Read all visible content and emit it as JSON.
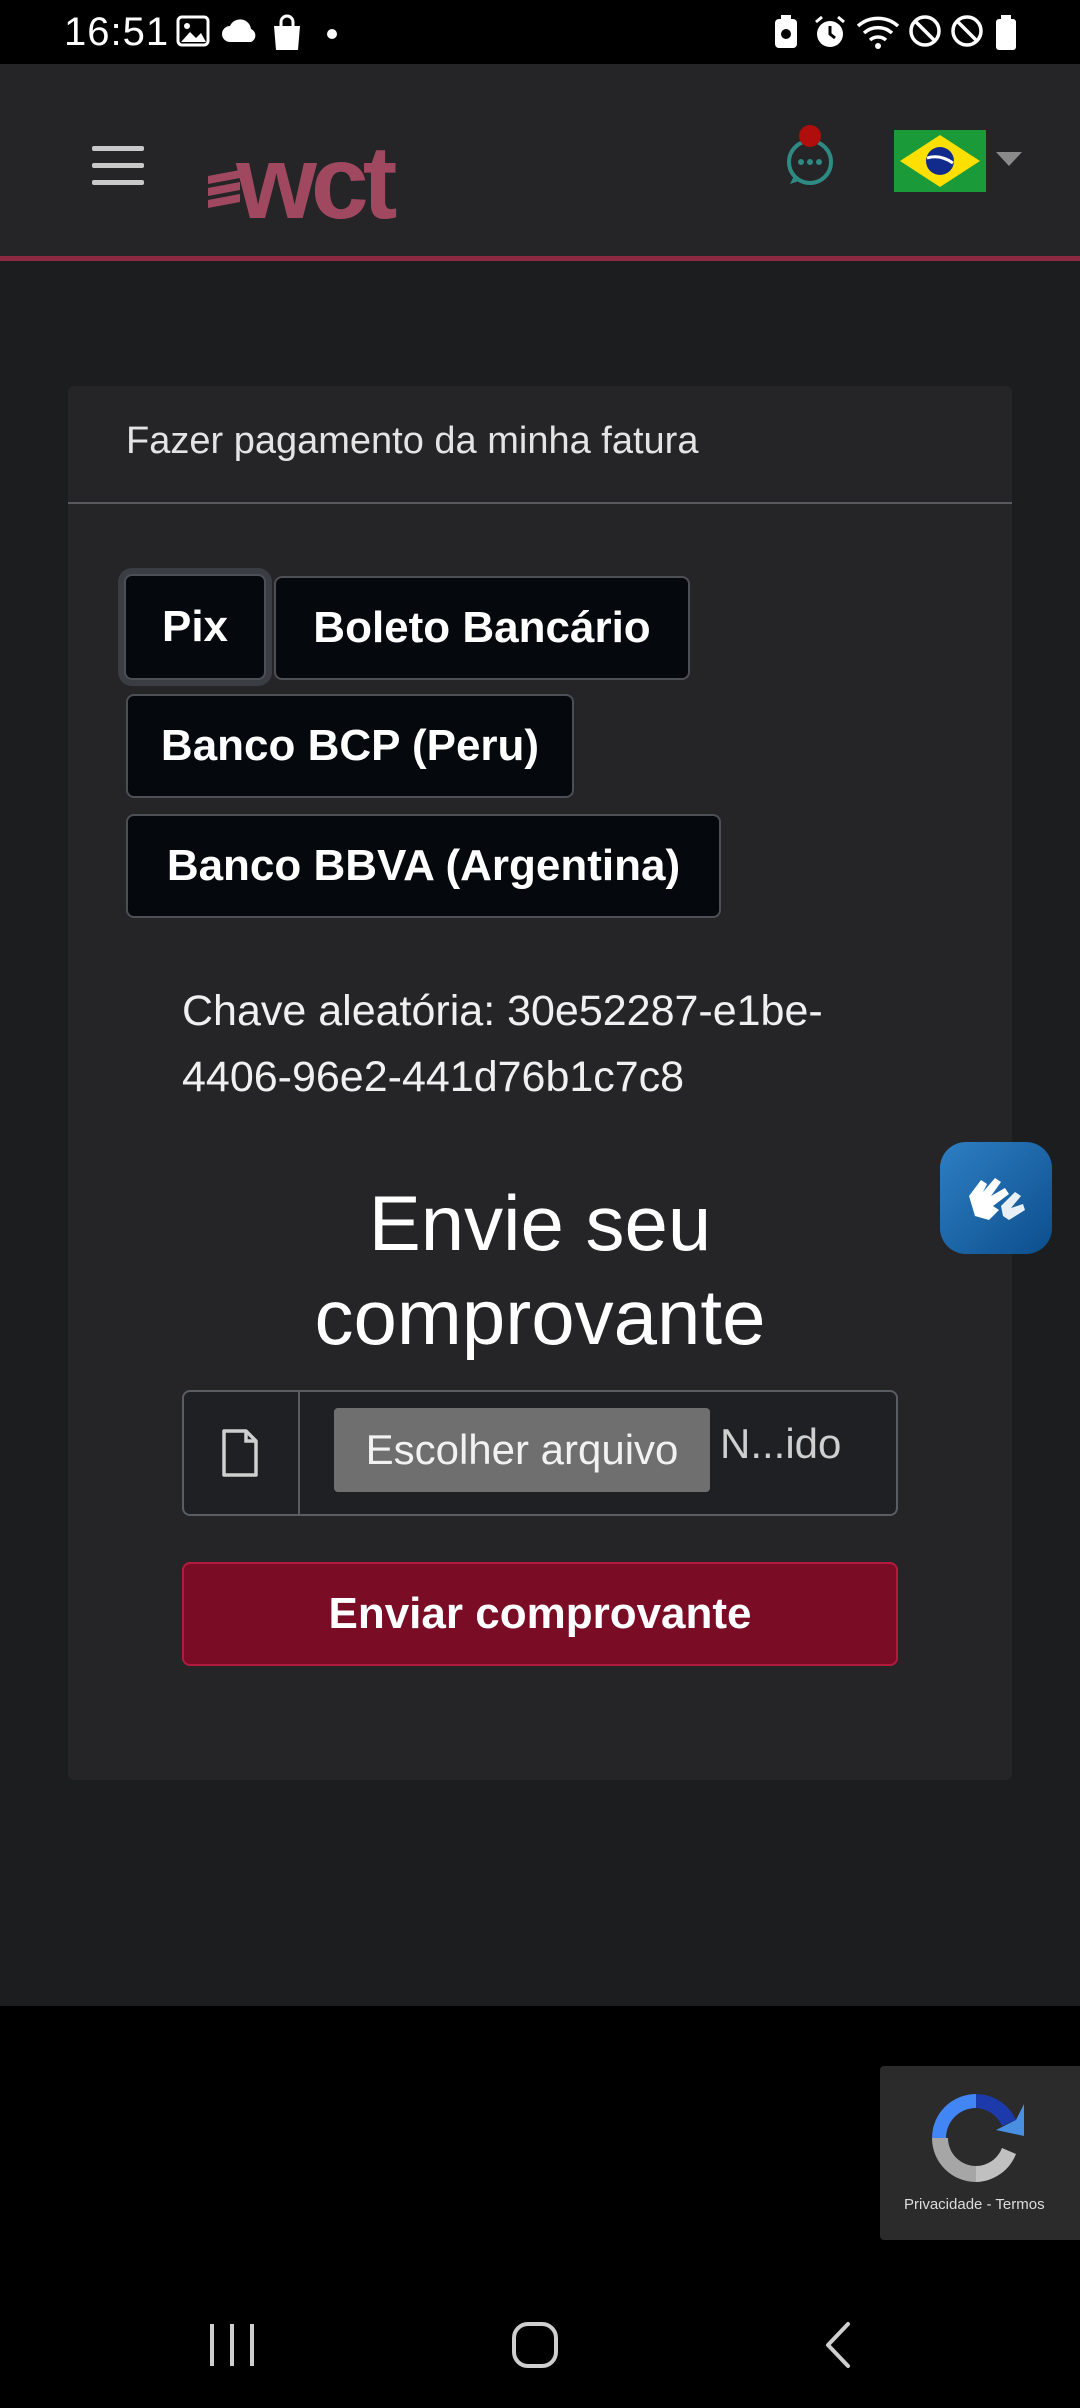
{
  "status_bar": {
    "time": "16:51",
    "left_icons": [
      "image-icon",
      "cloud-icon",
      "shopping-bag-icon",
      "dot-icon"
    ],
    "right_icons": [
      "battery-saver-icon",
      "alarm-icon",
      "wifi-icon",
      "do-not-disturb-icon",
      "block-icon",
      "battery-icon"
    ]
  },
  "header": {
    "logo_text": "wct",
    "menu_icon": "hamburger-menu-icon",
    "chat_icon": "chat-bubble-icon",
    "language_flag": "brazil-flag-icon",
    "colors": {
      "header_bg": "#252527",
      "accent": "#8c2a44",
      "logo": "#a0485f"
    }
  },
  "card": {
    "title": "Fazer pagamento da minha fatura",
    "payment_methods": [
      "Pix",
      "Boleto Bancário",
      "Banco BCP (Peru)",
      "Banco BBVA (Argentina)"
    ],
    "selected_method": "Pix",
    "pix_key_label": "Chave aleatória: 30e52287-e1be-4406-96e2-441d76b1c7c8",
    "upload_heading": "Envie seu comprovante",
    "file_input": {
      "icon": "file-icon",
      "button_label": "Escolher arquivo",
      "status_text": "N...ido"
    },
    "submit_label": "Enviar comprovante",
    "colors": {
      "submit_bg": "#7a0c26"
    }
  },
  "floating": {
    "accessibility_icon": "sign-language-hands-icon"
  },
  "recaptcha": {
    "text": "Privacidade - Termos"
  },
  "nav_bar": {
    "icons": [
      "recent-apps-icon",
      "home-icon",
      "back-icon"
    ]
  }
}
